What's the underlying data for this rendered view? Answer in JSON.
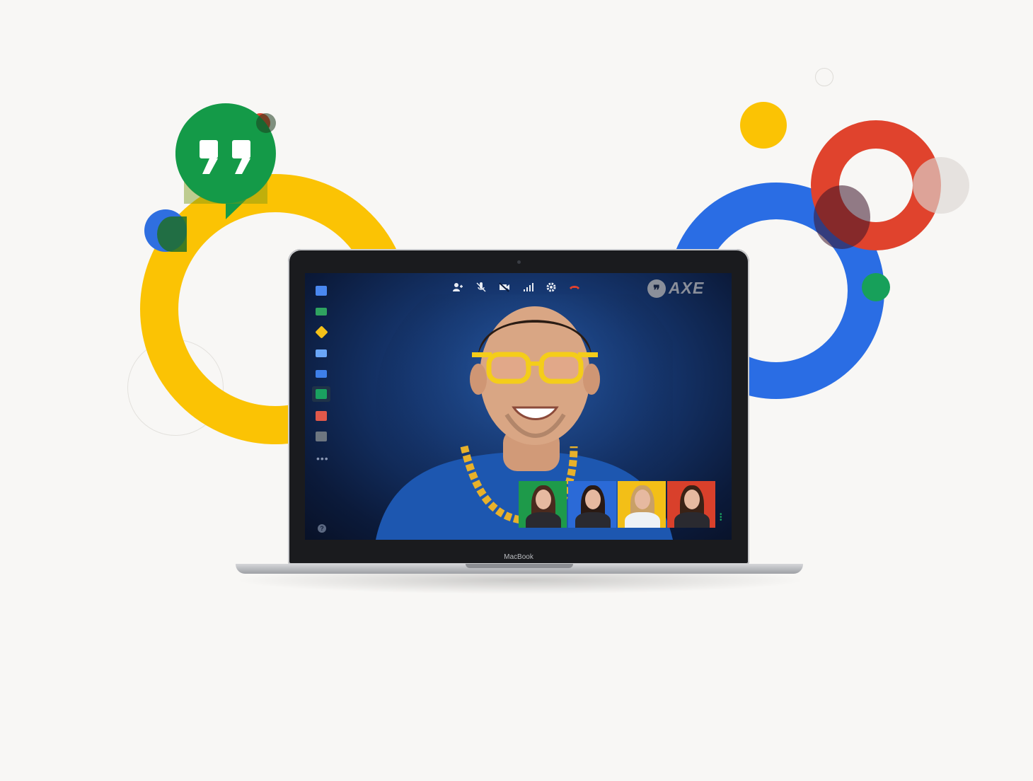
{
  "background": {
    "colors": {
      "yellow": "#fbc304",
      "blue": "#2a6de4",
      "red": "#e0432d",
      "green": "#17a05a"
    },
    "logo_icon": "hangouts-quote-icon"
  },
  "laptop": {
    "brand": "MacBook"
  },
  "app": {
    "brand_text": "AXE",
    "brand_icon": "hangouts-quote-icon",
    "sidebar": [
      {
        "name": "chat-icon",
        "color": "#4a88f0"
      },
      {
        "name": "screenshare-icon",
        "color": "#2fa360"
      },
      {
        "name": "tag-icon",
        "color": "#f5c118"
      },
      {
        "name": "camera-icon",
        "color": "#6aa6f8"
      },
      {
        "name": "video-icon",
        "color": "#3e7fe8"
      },
      {
        "name": "messages-icon",
        "color": "#1aa260"
      },
      {
        "name": "toolbox-icon",
        "color": "#e0584a"
      },
      {
        "name": "apps-icon",
        "color": "#6d7680"
      }
    ],
    "sidebar_more": "•••",
    "help_label": "?",
    "toolbar": [
      {
        "name": "add-person-icon",
        "glyph": "👤"
      },
      {
        "name": "mute-mic-icon",
        "glyph": "🎤"
      },
      {
        "name": "video-off-icon",
        "glyph": "▶"
      },
      {
        "name": "signal-icon",
        "glyph": "▮"
      },
      {
        "name": "settings-icon",
        "glyph": "⚙"
      },
      {
        "name": "hang-up-icon",
        "glyph": "☎"
      }
    ],
    "participants": [
      {
        "bg": "#1e9a4a",
        "hair": "#4a2a1e"
      },
      {
        "bg": "#2b6ad7",
        "hair": "#2a1a14"
      },
      {
        "bg": "#f3bf17",
        "hair": "#c9a066"
      },
      {
        "bg": "#d9402b",
        "hair": "#3a2216"
      }
    ]
  }
}
